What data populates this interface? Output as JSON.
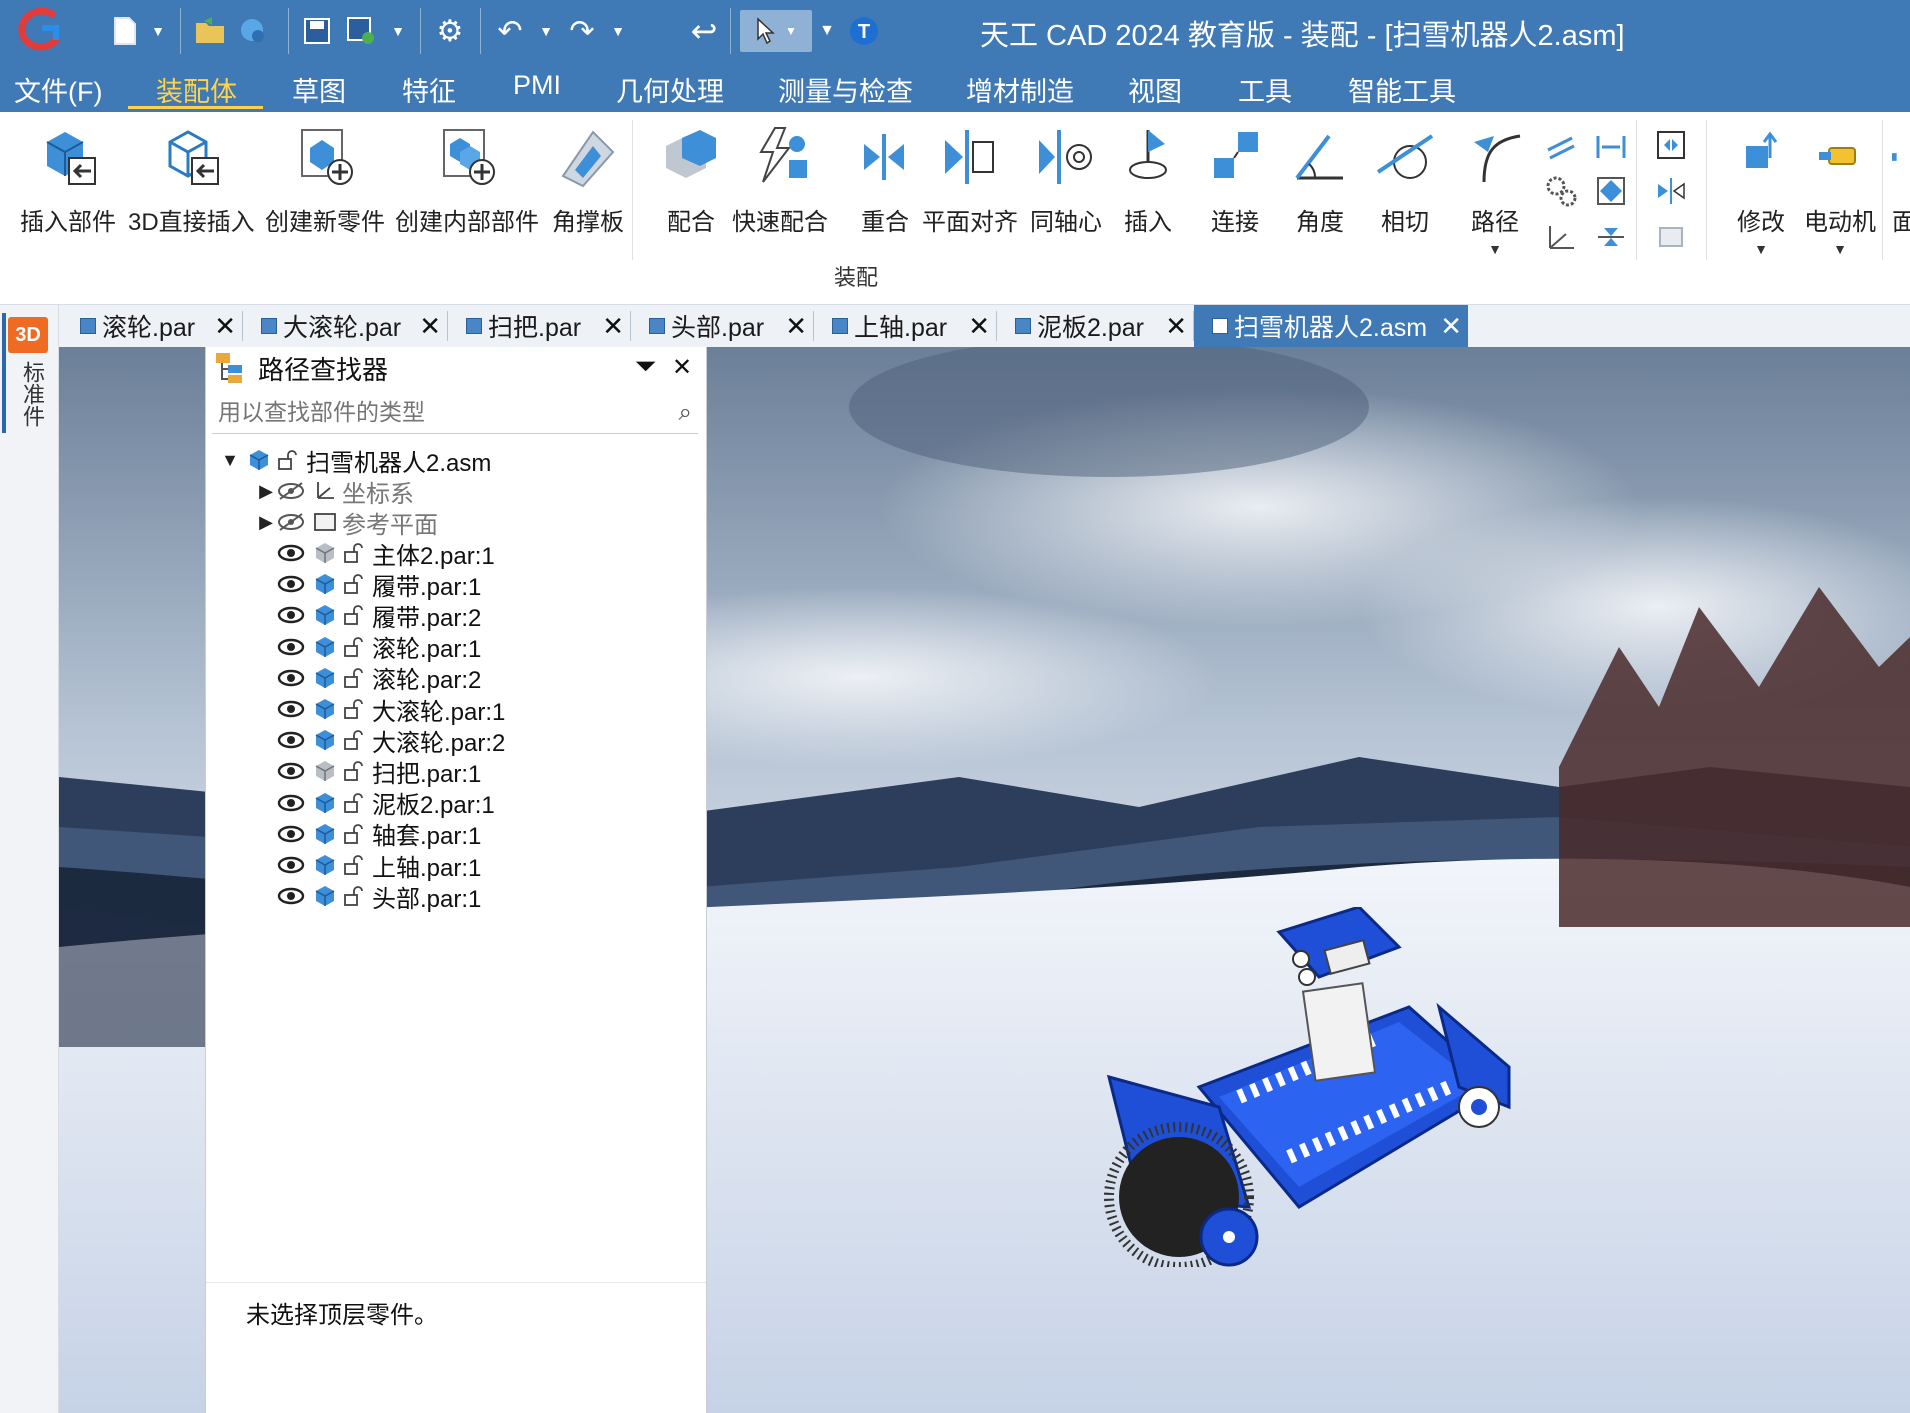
{
  "window": {
    "title": "天工 CAD 2024 教育版 - 装配 - [扫雪机器人2.asm]"
  },
  "menu": {
    "items": [
      {
        "label": "文件(F)"
      },
      {
        "label": "装配体"
      },
      {
        "label": "草图"
      },
      {
        "label": "特征"
      },
      {
        "label": "PMI"
      },
      {
        "label": "几何处理"
      },
      {
        "label": "测量与检查"
      },
      {
        "label": "增材制造"
      },
      {
        "label": "视图"
      },
      {
        "label": "工具"
      },
      {
        "label": "智能工具"
      }
    ],
    "active": "装配体"
  },
  "ribbon": {
    "buttons": [
      {
        "label": "插入部件",
        "icon": "insert-part-icon"
      },
      {
        "label": "3D直接插入",
        "icon": "3d-insert-icon"
      },
      {
        "label": "创建新零件",
        "icon": "new-part-icon"
      },
      {
        "label": "创建内部部件",
        "icon": "internal-part-icon"
      },
      {
        "label": "角撑板",
        "icon": "gusset-icon"
      },
      {
        "label": "配合",
        "icon": "mate-icon"
      },
      {
        "label": "快速配合",
        "icon": "quick-mate-icon"
      },
      {
        "label": "重合",
        "icon": "coincident-icon"
      },
      {
        "label": "平面对齐",
        "icon": "plane-align-icon"
      },
      {
        "label": "同轴心",
        "icon": "coaxial-icon"
      },
      {
        "label": "插入",
        "icon": "insert-icon"
      },
      {
        "label": "连接",
        "icon": "connect-icon"
      },
      {
        "label": "角度",
        "icon": "angle-icon"
      },
      {
        "label": "相切",
        "icon": "tangent-icon"
      },
      {
        "label": "路径",
        "icon": "path-icon"
      },
      {
        "label": "修改",
        "icon": "modify-icon"
      },
      {
        "label": "电动机",
        "icon": "motor-icon"
      },
      {
        "label": "面",
        "icon": "face-icon"
      }
    ],
    "group_label": "装配"
  },
  "tabs": [
    {
      "label": "滚轮.par"
    },
    {
      "label": "大滚轮.par"
    },
    {
      "label": "扫把.par"
    },
    {
      "label": "头部.par"
    },
    {
      "label": "上轴.par"
    },
    {
      "label": "泥板2.par"
    },
    {
      "label": "扫雪机器人2.asm"
    }
  ],
  "left_strip": {
    "badge": "3D",
    "label": "标准件"
  },
  "pathfinder": {
    "title": "路径查找器",
    "search_placeholder": "用以查找部件的类型",
    "root": "扫雪机器人2.asm",
    "groups": [
      {
        "label": "坐标系"
      },
      {
        "label": "参考平面"
      }
    ],
    "parts": [
      {
        "label": "主体2.par:1"
      },
      {
        "label": "履带.par:1"
      },
      {
        "label": "履带.par:2"
      },
      {
        "label": "滚轮.par:1"
      },
      {
        "label": "滚轮.par:2"
      },
      {
        "label": "大滚轮.par:1"
      },
      {
        "label": "大滚轮.par:2"
      },
      {
        "label": "扫把.par:1"
      },
      {
        "label": "泥板2.par:1"
      },
      {
        "label": "轴套.par:1"
      },
      {
        "label": "上轴.par:1"
      },
      {
        "label": "头部.par:1"
      }
    ],
    "status": "未选择顶层零件。"
  },
  "colors": {
    "titlebar": "#3f79b6",
    "menu_active": "#ffd24a",
    "model_blue": "#1e4fd6"
  }
}
